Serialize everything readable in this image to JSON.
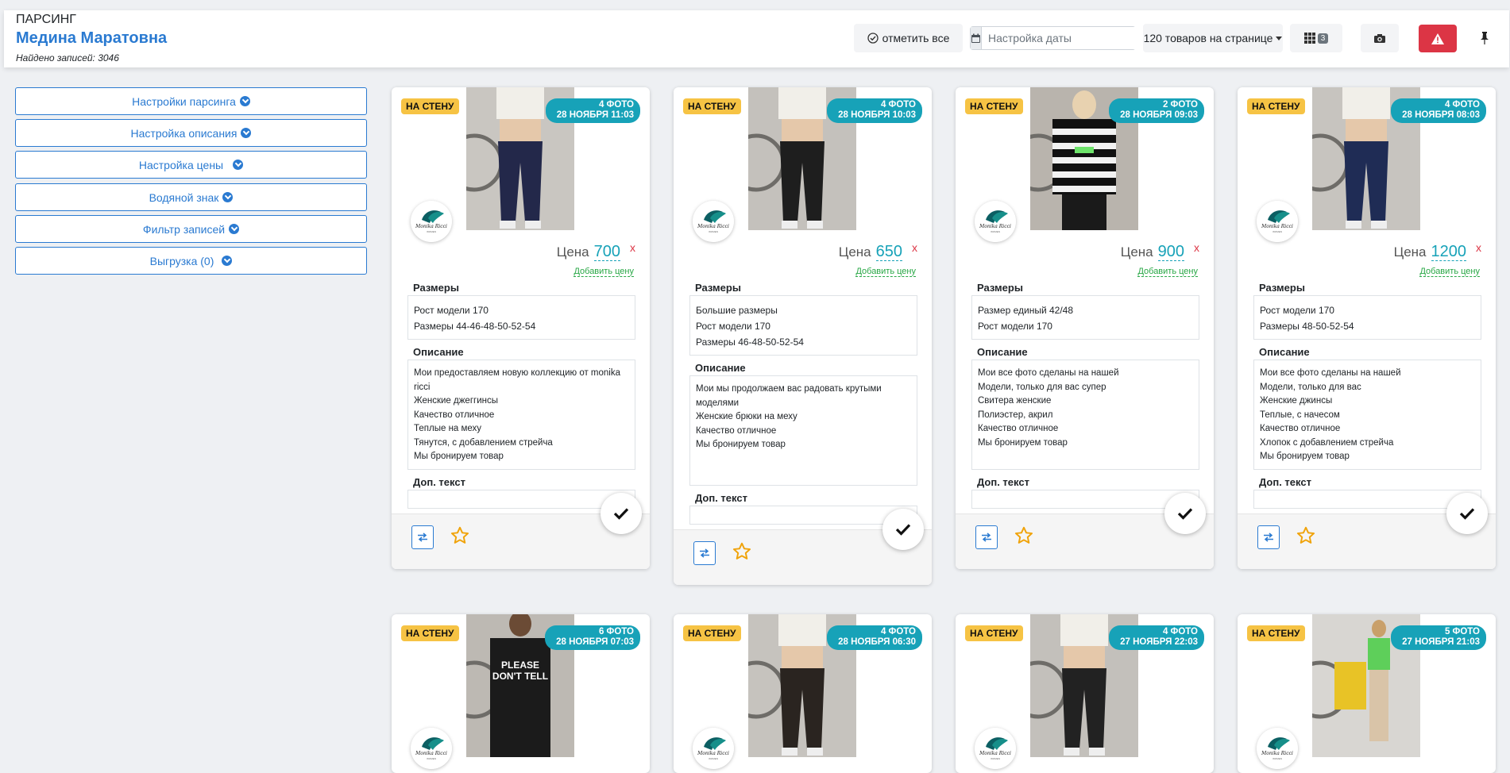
{
  "header": {
    "section": "ПАРСИНГ",
    "name": "Медина Маратовна",
    "found": "Найдено записей: 3046",
    "mark_all": "отметить все",
    "date_placeholder": "Настройка даты",
    "per_page": "120 товаров на странице",
    "grid_count": "3"
  },
  "sidebar": [
    {
      "label": "Настройки парсинга"
    },
    {
      "label": "Настройка описания"
    },
    {
      "label": "Настройка цены"
    },
    {
      "label": "Водяной знак"
    },
    {
      "label": "Фильтр записей"
    },
    {
      "label": "Выгрузка (0)"
    }
  ],
  "labels": {
    "wall": "НА СТЕНУ",
    "price": "Цена",
    "remove": "x",
    "add_price": "Добавить цену",
    "sizes": "Размеры",
    "description": "Описание",
    "extra": "Доп. текст"
  },
  "cards": [
    {
      "photos": "4 ФОТО",
      "date": "28 НОЯБРЯ 11:03",
      "price": "700",
      "sizes": [
        "Рост модели 170",
        "Размеры 44-46-48-50-52-54"
      ],
      "desc": [
        "Мои предоставляем новую коллекцию от monika",
        "ricci",
        "Женские джеггинсы",
        "Качество отличное",
        "Теплые на меху",
        "Тянутся, с добавлением стрейча",
        "Мы бронируем товар"
      ],
      "photo_color": "#c9c6c1",
      "cloth": "#23284a"
    },
    {
      "photos": "4 ФОТО",
      "date": "28 НОЯБРЯ 10:03",
      "price": "650",
      "sizes": [
        "Большие размеры",
        "Рост модели 170",
        "Размеры 46-48-50-52-54"
      ],
      "desc": [
        "Мои мы продолжаем вас радовать крутыми",
        "моделями",
        "Женские брюки на меху",
        "Качество отличное",
        "Мы бронируем товар"
      ],
      "photo_color": "#c4c1bc",
      "cloth": "#1e1e1e"
    },
    {
      "photos": "2 ФОТО",
      "date": "28 НОЯБРЯ 09:03",
      "price": "900",
      "sizes": [
        "Размер единый 42/48",
        "Рост модели 170"
      ],
      "desc": [
        "Мои все фото сделаны на нашей",
        "Модели, только для вас супер",
        "Свитера женские",
        "Полиэстер, акрил",
        "Качество отличное",
        "Мы бронируем товар"
      ],
      "photo_color": "#b9b4ad",
      "cloth": "#111111"
    },
    {
      "photos": "4 ФОТО",
      "date": "28 НОЯБРЯ 08:03",
      "price": "1200",
      "sizes": [
        "Рост модели 170",
        "Размеры 48-50-52-54"
      ],
      "desc": [
        "Мои все фото сделаны на нашей",
        "Модели, только для вас",
        "Женские джинсы",
        "Теплые, с начесом",
        "Качество отличное",
        "Хлопок с добавлением стрейча",
        "Мы бронируем товар"
      ],
      "photo_color": "#c7c4bf",
      "cloth": "#1f2c55"
    },
    {
      "photos": "6 ФОТО",
      "date": "28 НОЯБРЯ 07:03",
      "photo_color": "#bdb9b3",
      "cloth": "#1b1b1b",
      "print_text": "PLEASE\nDON'T TELL"
    },
    {
      "photos": "4 ФОТО",
      "date": "28 НОЯБРЯ 06:30",
      "photo_color": "#c6c3be",
      "cloth": "#2a2420"
    },
    {
      "photos": "4 ФОТО",
      "date": "27 НОЯБРЯ 22:03",
      "photo_color": "#c3c0bb",
      "cloth": "#222222"
    },
    {
      "photos": "5 ФОТО",
      "date": "27 НОЯБРЯ 21:03",
      "photo_color": "#d8d6d2",
      "cloth": "#5ecf5a"
    }
  ]
}
